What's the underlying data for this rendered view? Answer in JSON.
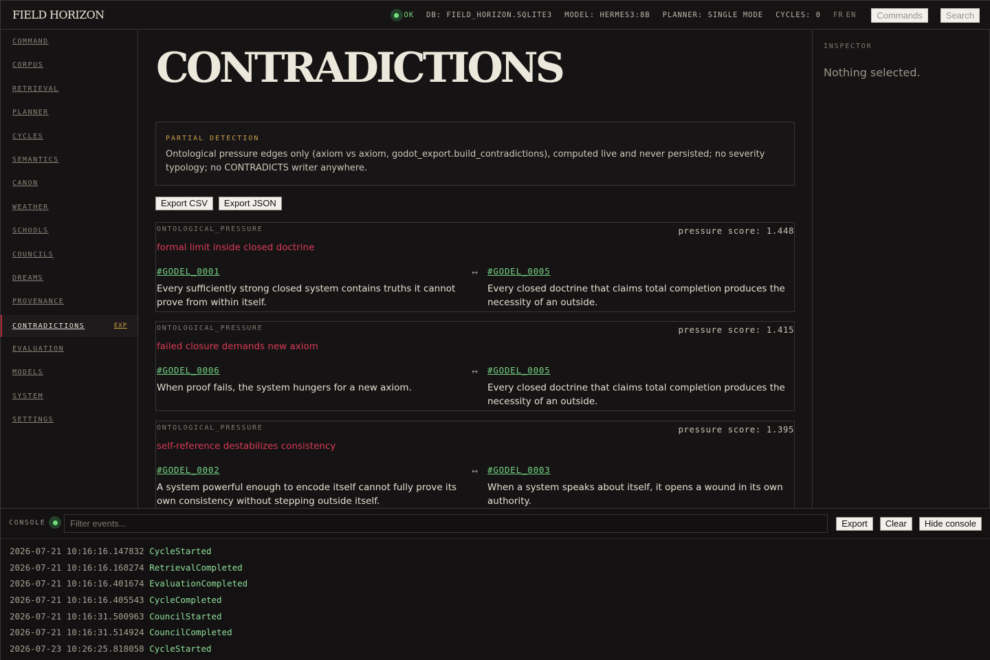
{
  "app": {
    "brand": "FIELD HORIZON",
    "status": "OK",
    "db": "DB: FIELD_HORIZON.SQLITE3",
    "model": "MODEL: HERMES3:8B",
    "planner": "PLANNER: SINGLE MODE",
    "cycles": "CYCLES: 0",
    "lang_fr": "FR",
    "lang_en": "EN",
    "commands_label": "Commands",
    "search_label": "Search"
  },
  "sidebar": {
    "items": [
      {
        "label": "COMMAND"
      },
      {
        "label": "CORPUS"
      },
      {
        "label": "RETRIEVAL"
      },
      {
        "label": "PLANNER"
      },
      {
        "label": "CYCLES"
      },
      {
        "label": "SEMANTICS"
      },
      {
        "label": "CANON"
      },
      {
        "label": "WEATHER"
      },
      {
        "label": "SCHOOLS"
      },
      {
        "label": "COUNCILS"
      },
      {
        "label": "DREAMS"
      },
      {
        "label": "PROVENANCE"
      },
      {
        "label": "CONTRADICTIONS",
        "badge": "EXP",
        "active": true
      },
      {
        "label": "EVALUATION"
      },
      {
        "label": "MODELS"
      },
      {
        "label": "SYSTEM"
      },
      {
        "label": "SETTINGS"
      }
    ]
  },
  "main": {
    "title": "CONTRADICTIONS",
    "notice": {
      "label": "PARTIAL DETECTION",
      "text": "Ontological pressure edges only (axiom vs axiom, godot_export.build_contradictions), computed live and never persisted; no severity typology; no CONTRADICTS writer anywhere."
    },
    "export_csv": "Export CSV",
    "export_json": "Export JSON",
    "cards": [
      {
        "kind": "ONTOLOGICAL_PRESSURE",
        "score": "pressure score: 1.448",
        "title": "formal limit inside closed doctrine",
        "left_ref": "#GODEL_0001",
        "left_text": "Every sufficiently strong closed system contains truths it cannot prove from within itself.",
        "arrow": "↔",
        "right_ref": "#GODEL_0005",
        "right_text": "Every closed doctrine that claims total completion produces the necessity of an outside."
      },
      {
        "kind": "ONTOLOGICAL_PRESSURE",
        "score": "pressure score: 1.415",
        "title": "failed closure demands new axiom",
        "left_ref": "#GODEL_0006",
        "left_text": "When proof fails, the system hungers for a new axiom.",
        "arrow": "↔",
        "right_ref": "#GODEL_0005",
        "right_text": "Every closed doctrine that claims total completion produces the necessity of an outside."
      },
      {
        "kind": "ONTOLOGICAL_PRESSURE",
        "score": "pressure score: 1.395",
        "title": "self-reference destabilizes consistency",
        "left_ref": "#GODEL_0002",
        "left_text": "A system powerful enough to encode itself cannot fully prove its own consistency without stepping outside itself.",
        "arrow": "↔",
        "right_ref": "#GODEL_0003",
        "right_text": "When a system speaks about itself, it opens a wound in its own authority."
      }
    ]
  },
  "inspector": {
    "label": "INSPECTOR",
    "empty": "Nothing selected."
  },
  "console": {
    "label": "CONSOLE",
    "filter_placeholder": "Filter events...",
    "export_label": "Export",
    "clear_label": "Clear",
    "hide_label": "Hide console",
    "events": [
      {
        "ts": "2026-07-21 10:16:16.147832",
        "name": "CycleStarted"
      },
      {
        "ts": "2026-07-21 10:16:16.168274",
        "name": "RetrievalCompleted"
      },
      {
        "ts": "2026-07-21 10:16:16.401674",
        "name": "EvaluationCompleted"
      },
      {
        "ts": "2026-07-21 10:16:16.405543",
        "name": "CycleCompleted"
      },
      {
        "ts": "2026-07-21 10:16:31.500963",
        "name": "CouncilStarted"
      },
      {
        "ts": "2026-07-21 10:16:31.514924",
        "name": "CouncilCompleted"
      },
      {
        "ts": "2026-07-23 10:26:25.818058",
        "name": "CycleStarted"
      }
    ]
  },
  "colors": {
    "background": "#161314",
    "accent_red": "#d93b57",
    "active_border": "#b02a3c",
    "ref_green": "#74d585",
    "ok_green": "#6fd57a",
    "amber": "#c9a04b"
  },
  "icons": {
    "status": "status-dot-icon",
    "console": "console-status-dot-icon",
    "link": "bidirectional-arrow-icon"
  }
}
